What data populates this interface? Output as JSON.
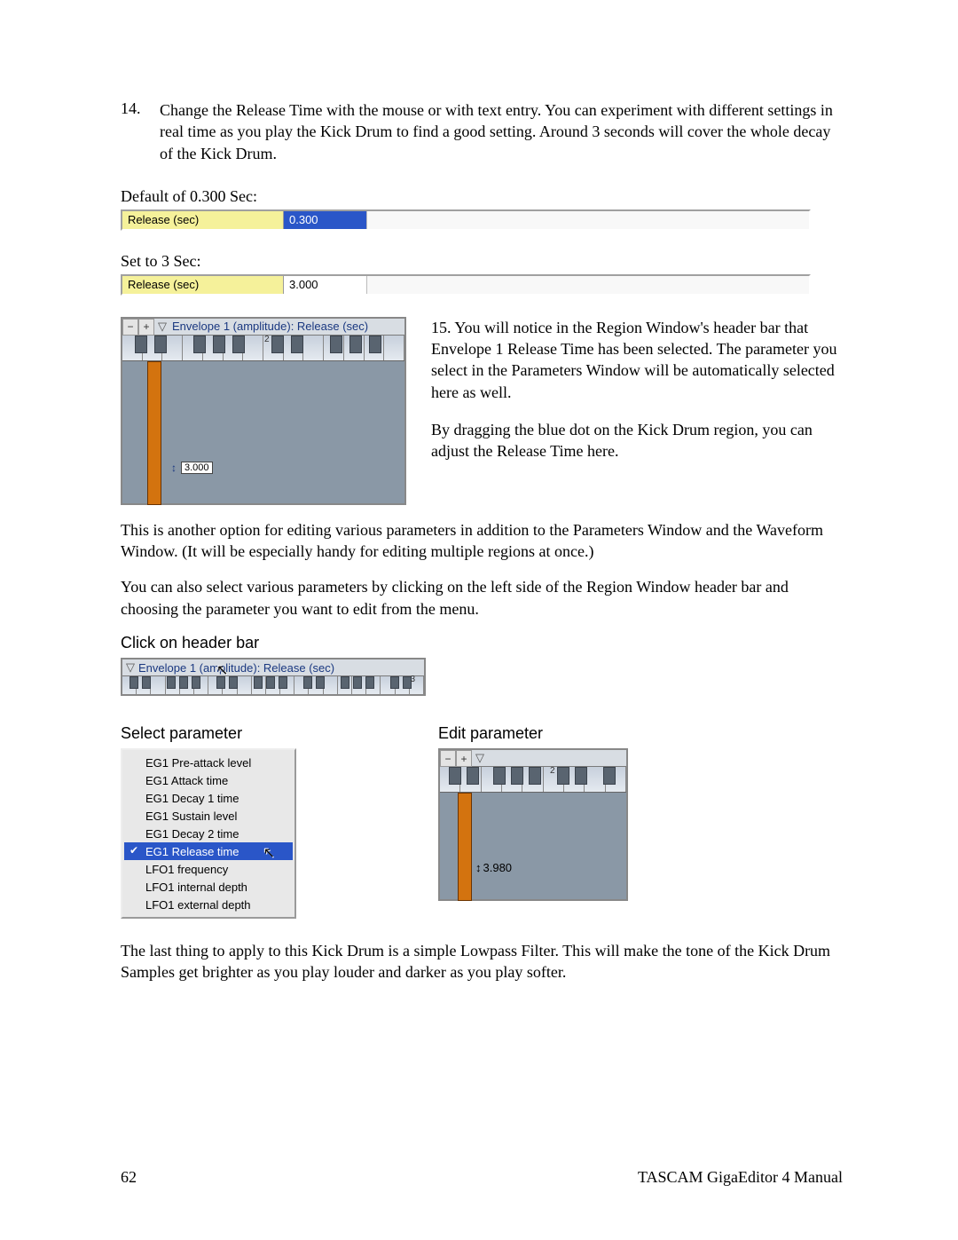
{
  "step14": {
    "num": "14.",
    "text": "Change the Release Time with the mouse or with text entry. You can experiment with different settings in real time as you play the Kick Drum to find a good setting.  Around 3 seconds will cover the whole decay of the Kick Drum."
  },
  "default_label": "Default of 0.300 Sec:",
  "row1": {
    "label": "Release (sec)",
    "value": "0.300"
  },
  "set_label": "Set to 3 Sec:",
  "row2": {
    "label": "Release (sec)",
    "value": "3.000"
  },
  "region1": {
    "title": "Envelope 1 (amplitude): Release (sec)",
    "tick": "2",
    "value": "3.000"
  },
  "step15": {
    "p1": "15. You will notice in the Region Window's header bar that Envelope 1 Release Time has been selected. The parameter you select in the Parameters Window will be automatically selected here as well.",
    "p2": "By dragging the blue dot on the Kick Drum region, you can adjust the Release Time here."
  },
  "para2": "This is another option for editing various parameters in addition to the Parameters Window and the Waveform Window.  (It will be especially handy for editing multiple regions at once.)",
  "para3": "You can also select various parameters by clicking on the left side of the Region Window header bar and choosing the parameter you want to edit from the menu.",
  "h_click": "Click on header bar",
  "clickbar_title": "Envelope 1 (amplitude): Release (sec)",
  "clickbar_tick": "3",
  "h_select": "Select parameter",
  "menu": {
    "items": [
      "EG1 Pre-attack level",
      "EG1 Attack time",
      "EG1 Decay 1 time",
      "EG1 Sustain level",
      "EG1 Decay 2 time",
      "EG1 Release time",
      "LFO1 frequency",
      "LFO1 internal depth",
      "LFO1 external depth"
    ],
    "selected_index": 5
  },
  "h_edit": "Edit parameter",
  "region2": {
    "tick": "2",
    "value": "3.980"
  },
  "para4": "The last thing to apply to this Kick Drum is a simple Lowpass Filter.  This will make the tone of the Kick Drum Samples get brighter as you play louder and darker as you play softer.",
  "footer": {
    "page": "62",
    "title": "TASCAM GigaEditor 4 Manual"
  }
}
